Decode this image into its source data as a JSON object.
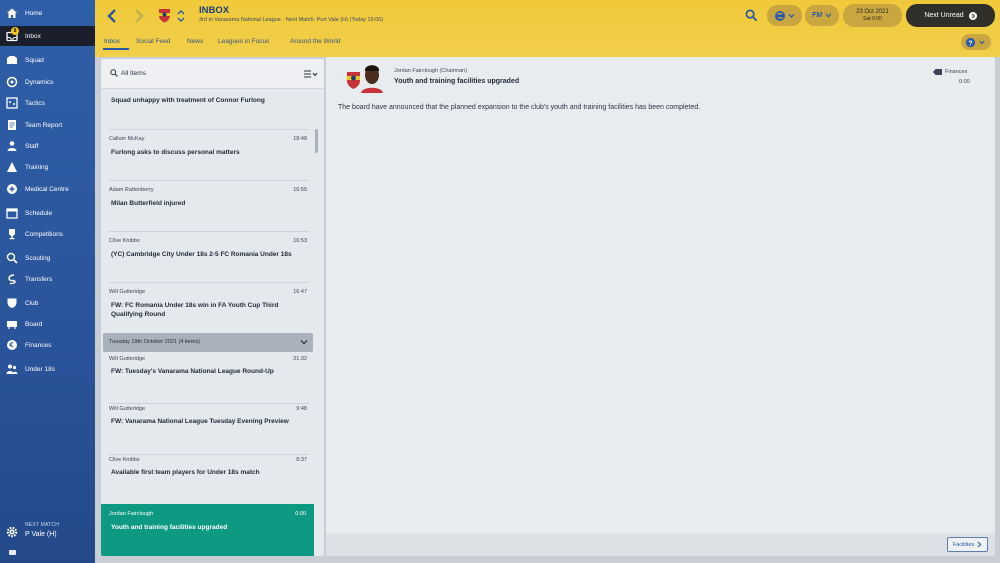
{
  "sidebar": {
    "items": [
      {
        "label": "Home",
        "icon": "home-icon"
      },
      {
        "label": "Inbox",
        "icon": "inbox-icon",
        "badge": "8"
      },
      {
        "label": "Squad",
        "icon": "squad-icon"
      },
      {
        "label": "Dynamics",
        "icon": "dynamics-icon"
      },
      {
        "label": "Tactics",
        "icon": "tactics-icon"
      },
      {
        "label": "Team Report",
        "icon": "team-report-icon"
      },
      {
        "label": "Staff",
        "icon": "staff-icon"
      },
      {
        "label": "Training",
        "icon": "training-icon"
      },
      {
        "label": "Medical Centre",
        "icon": "medical-icon"
      },
      {
        "label": "Schedule",
        "icon": "schedule-icon"
      },
      {
        "label": "Competitions",
        "icon": "competitions-icon"
      },
      {
        "label": "Scouting",
        "icon": "scouting-icon"
      },
      {
        "label": "Transfers",
        "icon": "transfers-icon"
      },
      {
        "label": "Club",
        "icon": "club-icon"
      },
      {
        "label": "Board",
        "icon": "board-icon"
      },
      {
        "label": "Finances",
        "icon": "finances-icon"
      },
      {
        "label": "Under 18s",
        "icon": "under18s-icon"
      }
    ],
    "active_index": 1,
    "next_match": {
      "title": "NEXT MATCH",
      "value": "P Vale (H)"
    }
  },
  "header": {
    "title": "INBOX",
    "subtitle": "3rd in Vanarama National League · Next Match: Port Vale (H) (Today 15:00)",
    "tabs": [
      "Inbox",
      "Social Feed",
      "News",
      "Leagues in Focus",
      "Around the World"
    ],
    "active_tab": 0,
    "date": "23 Oct 2021",
    "time": "Sat 0:00",
    "fm_label": "FM",
    "next_unread_label": "Next Unread"
  },
  "inbox": {
    "filter_label": "All Items",
    "messages": [
      {
        "sender": "",
        "time": "",
        "subject": "Squad unhappy with treatment of Connor Furlong"
      },
      {
        "sender": "Callum McKay",
        "time": "18:48",
        "subject": "Furlong asks to discuss personal matters"
      },
      {
        "sender": "Adam Rattenberry",
        "time": "16:55",
        "subject": "Milan Butterfield injured"
      },
      {
        "sender": "Clive Knibbs",
        "time": "16:53",
        "subject": "(YC) Cambridge City Under 18s 2-5 FC Romania Under 18s"
      },
      {
        "sender": "Will Gutteridge",
        "time": "16:47",
        "subject": "FW: FC Romania Under 18s win in FA Youth Cup Third Qualifying Round"
      },
      {
        "sender": "Will Gutteridge",
        "time": "21:32",
        "subject": "FW: Tuesday's Vanarama National League Round-Up"
      },
      {
        "sender": "Will Gutteridge",
        "time": "9:48",
        "subject": "FW: Vanarama National League Tuesday Evening Preview"
      },
      {
        "sender": "Clive Knibbs",
        "time": "8:37",
        "subject": "Available first team players for Under 18s match"
      },
      {
        "sender": "Jordan Fairclough",
        "time": "0:00",
        "subject": "Youth and training facilities upgraded"
      }
    ],
    "date_group": "Tuesday 19th October 2021 (4 items)",
    "selected_index": 8
  },
  "detail": {
    "from": "Jordan Fairclough  (Chairman)",
    "subject": "Youth and training facilities upgraded",
    "category": "Finances",
    "category_time": "0:00",
    "body": "The board have announced that the planned expansion to the club's youth and training facilities has been completed.",
    "action_label": "Facilities"
  },
  "colors": {
    "sidebar": "#2f5fa8",
    "header": "#f0c93a",
    "selected_message": "#0e9a82",
    "next_unread": "#2f2e28"
  }
}
